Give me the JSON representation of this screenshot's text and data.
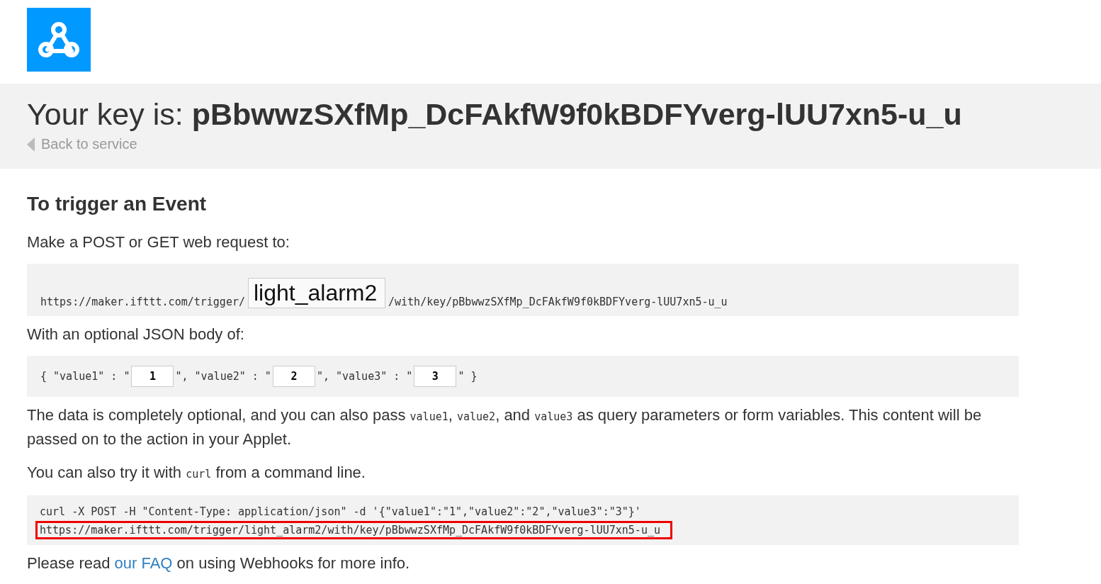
{
  "header": {
    "title_prefix": "Your key is:",
    "key": "pBbwwzSXfMp_DcFAkfW9f0kBDFYverg-lUU7xn5-u_u",
    "back_link": "Back to service"
  },
  "section": {
    "heading": "To trigger an Event",
    "request_intro": "Make a POST or GET web request to:",
    "url_prefix": "https://maker.ifttt.com/trigger/",
    "event_name": "light_alarm2",
    "url_suffix": "/with/key/pBbwwzSXfMp_DcFAkfW9f0kBDFYverg-lUU7xn5-u_u",
    "body_intro": "With an optional JSON body of:",
    "body_fields": [
      {
        "name_text": "{ \"value1\" : \"",
        "value": "1"
      },
      {
        "name_text": "\", \"value2\" : \"",
        "value": "2"
      },
      {
        "name_text": "\", \"value3\" : \"",
        "value": "3"
      }
    ],
    "body_close": "\" }",
    "description": [
      {
        "kind": "text",
        "text": "The data is completely optional, and you can also pass "
      },
      {
        "kind": "code",
        "text": "value1"
      },
      {
        "kind": "text",
        "text": ", "
      },
      {
        "kind": "code",
        "text": "value2"
      },
      {
        "kind": "text",
        "text": ", and "
      },
      {
        "kind": "code",
        "text": "value3"
      },
      {
        "kind": "text",
        "text": " as query parameters or form variables. This content will be passed on to the action in your Applet."
      }
    ],
    "curl_intro": [
      {
        "kind": "text",
        "text": "You can also try it with "
      },
      {
        "kind": "code",
        "text": "curl"
      },
      {
        "kind": "text",
        "text": " from a command line."
      }
    ],
    "curl_lines": [
      {
        "text": "curl -X POST -H \"Content-Type: application/json\" -d '{\"value1\":\"1\",\"value2\":\"2\",\"value3\":\"3\"}'",
        "highlighted": false
      },
      {
        "text": "https://maker.ifttt.com/trigger/light_alarm2/with/key/pBbwwzSXfMp_DcFAkfW9f0kBDFYverg-lUU7xn5-u_u",
        "highlighted": true
      }
    ],
    "footer": {
      "before": "Please read ",
      "link": "our FAQ",
      "after": " on using Webhooks for more info."
    }
  }
}
